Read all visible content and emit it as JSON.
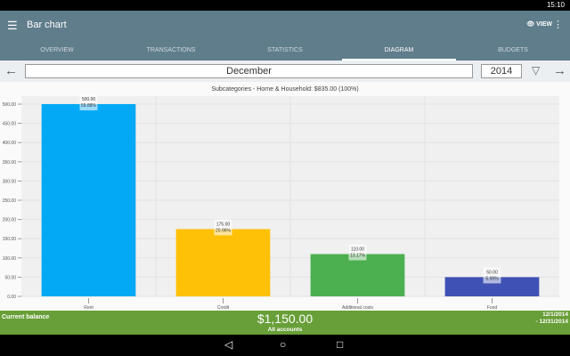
{
  "status": {
    "time": "15:10"
  },
  "toolbar": {
    "title": "Bar chart",
    "view_label": "VIEW"
  },
  "tabs": [
    "OVERVIEW",
    "TRANSACTIONS",
    "STATISTICS",
    "DIAGRAM",
    "BUDGETS"
  ],
  "active_tab": 3,
  "period": {
    "month": "December",
    "year": "2014"
  },
  "chart_data": {
    "type": "bar",
    "title": "Subcategories - Home & Household: $835.00 (100%)",
    "categories": [
      "Rent",
      "Credit",
      "Additional costs",
      "Food"
    ],
    "values": [
      500,
      175,
      110,
      50
    ],
    "value_labels": [
      "500.00",
      "175.00",
      "110.00",
      "50.00"
    ],
    "percent_labels": [
      "59.88%",
      "20.96%",
      "13.17%",
      "5.99%"
    ],
    "colors": [
      "#03a9f4",
      "#ffc107",
      "#4caf50",
      "#3f51b5"
    ],
    "yticks": [
      "0.00",
      "50.00",
      "100.00",
      "150.00",
      "200.00",
      "250.00",
      "300.00",
      "350.00",
      "400.00",
      "450.00",
      "500.00"
    ],
    "ylim": [
      0,
      500
    ],
    "grid": true
  },
  "balance": {
    "label": "Current balance",
    "amount": "$1,150.00",
    "accounts": "All accounts",
    "date_from": "12/1/2014",
    "date_to": "- 12/31/2014"
  },
  "colors": {
    "toolbar": "#607d8b",
    "balance_bar": "#689f38"
  }
}
